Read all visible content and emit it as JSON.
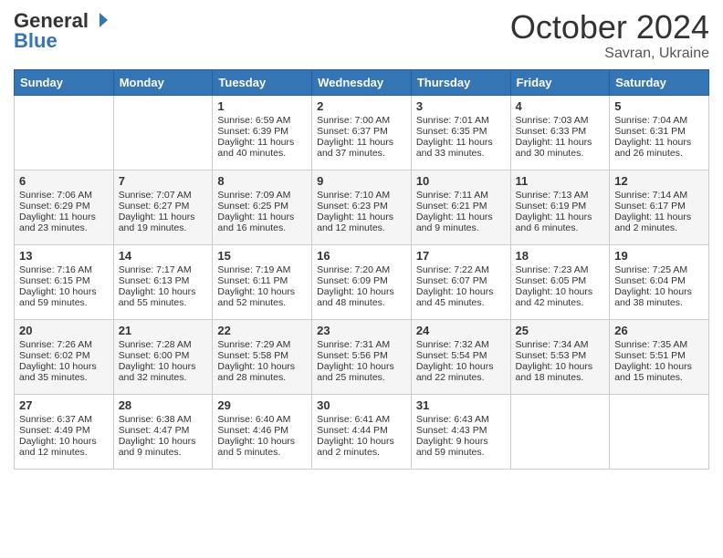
{
  "logo": {
    "general": "General",
    "blue": "Blue",
    "icon_symbol": "▶"
  },
  "header": {
    "month": "October 2024",
    "location": "Savran, Ukraine"
  },
  "days_of_week": [
    "Sunday",
    "Monday",
    "Tuesday",
    "Wednesday",
    "Thursday",
    "Friday",
    "Saturday"
  ],
  "weeks": [
    [
      {
        "day": "",
        "sunrise": "",
        "sunset": "",
        "daylight": ""
      },
      {
        "day": "",
        "sunrise": "",
        "sunset": "",
        "daylight": ""
      },
      {
        "day": "1",
        "sunrise": "Sunrise: 6:59 AM",
        "sunset": "Sunset: 6:39 PM",
        "daylight": "Daylight: 11 hours and 40 minutes."
      },
      {
        "day": "2",
        "sunrise": "Sunrise: 7:00 AM",
        "sunset": "Sunset: 6:37 PM",
        "daylight": "Daylight: 11 hours and 37 minutes."
      },
      {
        "day": "3",
        "sunrise": "Sunrise: 7:01 AM",
        "sunset": "Sunset: 6:35 PM",
        "daylight": "Daylight: 11 hours and 33 minutes."
      },
      {
        "day": "4",
        "sunrise": "Sunrise: 7:03 AM",
        "sunset": "Sunset: 6:33 PM",
        "daylight": "Daylight: 11 hours and 30 minutes."
      },
      {
        "day": "5",
        "sunrise": "Sunrise: 7:04 AM",
        "sunset": "Sunset: 6:31 PM",
        "daylight": "Daylight: 11 hours and 26 minutes."
      }
    ],
    [
      {
        "day": "6",
        "sunrise": "Sunrise: 7:06 AM",
        "sunset": "Sunset: 6:29 PM",
        "daylight": "Daylight: 11 hours and 23 minutes."
      },
      {
        "day": "7",
        "sunrise": "Sunrise: 7:07 AM",
        "sunset": "Sunset: 6:27 PM",
        "daylight": "Daylight: 11 hours and 19 minutes."
      },
      {
        "day": "8",
        "sunrise": "Sunrise: 7:09 AM",
        "sunset": "Sunset: 6:25 PM",
        "daylight": "Daylight: 11 hours and 16 minutes."
      },
      {
        "day": "9",
        "sunrise": "Sunrise: 7:10 AM",
        "sunset": "Sunset: 6:23 PM",
        "daylight": "Daylight: 11 hours and 12 minutes."
      },
      {
        "day": "10",
        "sunrise": "Sunrise: 7:11 AM",
        "sunset": "Sunset: 6:21 PM",
        "daylight": "Daylight: 11 hours and 9 minutes."
      },
      {
        "day": "11",
        "sunrise": "Sunrise: 7:13 AM",
        "sunset": "Sunset: 6:19 PM",
        "daylight": "Daylight: 11 hours and 6 minutes."
      },
      {
        "day": "12",
        "sunrise": "Sunrise: 7:14 AM",
        "sunset": "Sunset: 6:17 PM",
        "daylight": "Daylight: 11 hours and 2 minutes."
      }
    ],
    [
      {
        "day": "13",
        "sunrise": "Sunrise: 7:16 AM",
        "sunset": "Sunset: 6:15 PM",
        "daylight": "Daylight: 10 hours and 59 minutes."
      },
      {
        "day": "14",
        "sunrise": "Sunrise: 7:17 AM",
        "sunset": "Sunset: 6:13 PM",
        "daylight": "Daylight: 10 hours and 55 minutes."
      },
      {
        "day": "15",
        "sunrise": "Sunrise: 7:19 AM",
        "sunset": "Sunset: 6:11 PM",
        "daylight": "Daylight: 10 hours and 52 minutes."
      },
      {
        "day": "16",
        "sunrise": "Sunrise: 7:20 AM",
        "sunset": "Sunset: 6:09 PM",
        "daylight": "Daylight: 10 hours and 48 minutes."
      },
      {
        "day": "17",
        "sunrise": "Sunrise: 7:22 AM",
        "sunset": "Sunset: 6:07 PM",
        "daylight": "Daylight: 10 hours and 45 minutes."
      },
      {
        "day": "18",
        "sunrise": "Sunrise: 7:23 AM",
        "sunset": "Sunset: 6:05 PM",
        "daylight": "Daylight: 10 hours and 42 minutes."
      },
      {
        "day": "19",
        "sunrise": "Sunrise: 7:25 AM",
        "sunset": "Sunset: 6:04 PM",
        "daylight": "Daylight: 10 hours and 38 minutes."
      }
    ],
    [
      {
        "day": "20",
        "sunrise": "Sunrise: 7:26 AM",
        "sunset": "Sunset: 6:02 PM",
        "daylight": "Daylight: 10 hours and 35 minutes."
      },
      {
        "day": "21",
        "sunrise": "Sunrise: 7:28 AM",
        "sunset": "Sunset: 6:00 PM",
        "daylight": "Daylight: 10 hours and 32 minutes."
      },
      {
        "day": "22",
        "sunrise": "Sunrise: 7:29 AM",
        "sunset": "Sunset: 5:58 PM",
        "daylight": "Daylight: 10 hours and 28 minutes."
      },
      {
        "day": "23",
        "sunrise": "Sunrise: 7:31 AM",
        "sunset": "Sunset: 5:56 PM",
        "daylight": "Daylight: 10 hours and 25 minutes."
      },
      {
        "day": "24",
        "sunrise": "Sunrise: 7:32 AM",
        "sunset": "Sunset: 5:54 PM",
        "daylight": "Daylight: 10 hours and 22 minutes."
      },
      {
        "day": "25",
        "sunrise": "Sunrise: 7:34 AM",
        "sunset": "Sunset: 5:53 PM",
        "daylight": "Daylight: 10 hours and 18 minutes."
      },
      {
        "day": "26",
        "sunrise": "Sunrise: 7:35 AM",
        "sunset": "Sunset: 5:51 PM",
        "daylight": "Daylight: 10 hours and 15 minutes."
      }
    ],
    [
      {
        "day": "27",
        "sunrise": "Sunrise: 6:37 AM",
        "sunset": "Sunset: 4:49 PM",
        "daylight": "Daylight: 10 hours and 12 minutes."
      },
      {
        "day": "28",
        "sunrise": "Sunrise: 6:38 AM",
        "sunset": "Sunset: 4:47 PM",
        "daylight": "Daylight: 10 hours and 9 minutes."
      },
      {
        "day": "29",
        "sunrise": "Sunrise: 6:40 AM",
        "sunset": "Sunset: 4:46 PM",
        "daylight": "Daylight: 10 hours and 5 minutes."
      },
      {
        "day": "30",
        "sunrise": "Sunrise: 6:41 AM",
        "sunset": "Sunset: 4:44 PM",
        "daylight": "Daylight: 10 hours and 2 minutes."
      },
      {
        "day": "31",
        "sunrise": "Sunrise: 6:43 AM",
        "sunset": "Sunset: 4:43 PM",
        "daylight": "Daylight: 9 hours and 59 minutes."
      },
      {
        "day": "",
        "sunrise": "",
        "sunset": "",
        "daylight": ""
      },
      {
        "day": "",
        "sunrise": "",
        "sunset": "",
        "daylight": ""
      }
    ]
  ]
}
